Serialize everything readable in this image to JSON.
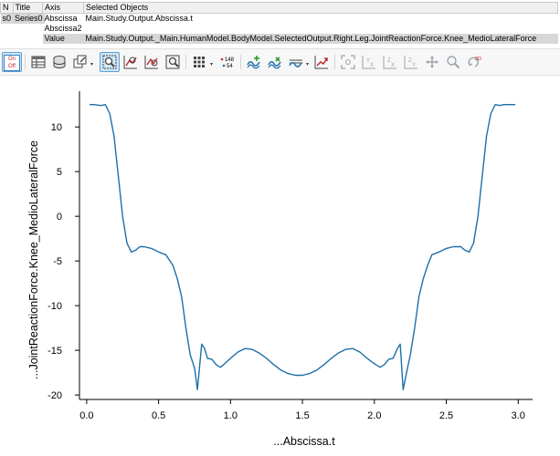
{
  "series_table": {
    "headers": [
      "N",
      "Title"
    ],
    "row": [
      "s0",
      "Series0"
    ]
  },
  "objects_table": {
    "headers": [
      "Axis",
      "Selected Objects"
    ],
    "rows": [
      {
        "axis": "Abscissa",
        "object": "Main.Study.Output.Abscissa.t"
      },
      {
        "axis": "Abscissa2",
        "object": ""
      },
      {
        "axis": "Value",
        "object": "Main.Study.Output._Main.HumanModel.BodyModel.SelectedOutput.Right.Leg.JointReactionForce.Knee_MedioLateralForce"
      }
    ]
  },
  "toolbar": {
    "onoff_on": "On",
    "onoff_off": "Off",
    "label_148": "148",
    "label_54": "54",
    "label_3d": "3D",
    "icons": [
      "on-off-toggle-icon",
      "table-view-icon",
      "database-icon",
      "export-icon",
      "zoom-region-icon",
      "zoom-fit-icon",
      "zoom-xy-icon",
      "zoom-window-icon",
      "grid-icon",
      "data-labels-icon",
      "curve-add-icon",
      "curve-style-icon",
      "curve-filter-icon",
      "curve-export-icon",
      "zoom-tool-icon",
      "zoom-x-icon",
      "zoom-z-icon",
      "zoom-y-icon",
      "pan-icon",
      "magnifier-icon",
      "rotate-3d-icon"
    ]
  },
  "colors": {
    "series_line": "#1f6fa8",
    "axis": "#000000"
  },
  "chart_data": {
    "type": "line",
    "title": "",
    "xlabel": "...Abscissa.t",
    "ylabel": "...JointReactionForce.Knee_MedioLateralForce",
    "xlim": [
      -0.05,
      3.1
    ],
    "ylim": [
      -20.5,
      14
    ],
    "x_ticks": [
      0.0,
      0.5,
      1.0,
      1.5,
      2.0,
      2.5,
      3.0
    ],
    "x_tick_labels": [
      "0.0",
      "0.5",
      "1.0",
      "1.5",
      "2.0",
      "2.5",
      "3.0"
    ],
    "y_ticks": [
      10,
      5,
      0,
      -5,
      -10,
      -15,
      -20
    ],
    "y_tick_labels": [
      "10",
      "5",
      "0",
      "-5",
      "-10",
      "-15",
      "-20"
    ],
    "grid": false,
    "legend": "none",
    "series": [
      {
        "x": [
          0.02,
          0.05,
          0.1,
          0.13,
          0.16,
          0.19,
          0.22,
          0.25,
          0.28,
          0.31,
          0.34,
          0.37,
          0.4,
          0.45,
          0.5,
          0.55,
          0.6,
          0.63,
          0.66,
          0.69,
          0.72,
          0.75,
          0.77,
          0.8,
          0.82,
          0.84,
          0.87,
          0.9,
          0.93,
          0.96,
          1.0,
          1.05,
          1.1,
          1.15,
          1.2,
          1.25,
          1.3,
          1.35,
          1.4,
          1.45,
          1.5,
          1.55,
          1.6,
          1.65,
          1.7,
          1.75,
          1.8,
          1.85,
          1.9,
          1.95,
          2.0,
          2.04,
          2.07,
          2.1,
          2.13,
          2.16,
          2.18,
          2.2,
          2.23,
          2.25,
          2.28,
          2.31,
          2.34,
          2.37,
          2.4,
          2.45,
          2.5,
          2.55,
          2.6,
          2.63,
          2.66,
          2.69,
          2.72,
          2.75,
          2.78,
          2.81,
          2.84,
          2.87,
          2.9,
          2.95,
          2.98
        ],
        "y": [
          12.5,
          12.5,
          12.4,
          12.5,
          11.5,
          9.0,
          4.5,
          0.0,
          -3.0,
          -4.0,
          -3.8,
          -3.4,
          -3.4,
          -3.6,
          -4.0,
          -4.3,
          -5.5,
          -7.0,
          -9.0,
          -12.5,
          -15.5,
          -17.0,
          -19.4,
          -14.3,
          -14.8,
          -15.9,
          -16.0,
          -16.6,
          -16.9,
          -16.5,
          -15.9,
          -15.2,
          -14.8,
          -14.9,
          -15.3,
          -15.9,
          -16.6,
          -17.2,
          -17.6,
          -17.8,
          -17.8,
          -17.6,
          -17.2,
          -16.6,
          -15.9,
          -15.3,
          -14.9,
          -14.8,
          -15.2,
          -15.9,
          -16.5,
          -16.9,
          -16.6,
          -16.0,
          -15.9,
          -14.8,
          -14.3,
          -19.4,
          -17.0,
          -15.5,
          -12.5,
          -9.0,
          -7.0,
          -5.5,
          -4.3,
          -4.0,
          -3.6,
          -3.4,
          -3.4,
          -3.8,
          -4.0,
          -3.0,
          0.0,
          4.5,
          9.0,
          11.5,
          12.5,
          12.4,
          12.5,
          12.5,
          12.5
        ]
      }
    ]
  }
}
